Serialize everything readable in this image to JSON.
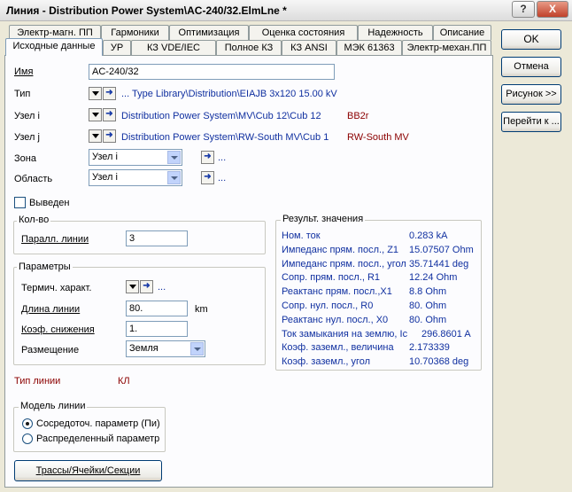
{
  "window": {
    "title": "Линия - Distribution Power System\\AC-240/32.ElmLne *",
    "help_label": "?",
    "close_label": "X"
  },
  "tabs_row1": [
    "Электр-магн. ПП",
    "Гармоники",
    "Оптимизация",
    "Оценка состояния",
    "Надежность",
    "Описание"
  ],
  "tabs_row2": [
    "Исходные данные",
    "УР",
    "КЗ VDE/IEC",
    "Полное КЗ",
    "КЗ ANSI",
    "МЭК 61363",
    "Электр-механ.ПП"
  ],
  "active_tab": "Исходные данные",
  "side_buttons": {
    "ok": "OK",
    "cancel": "Отмена",
    "figure": "Рисунок >>",
    "goto": "Перейти к ..."
  },
  "form": {
    "name_label": "Имя",
    "name_value": "AC-240/32",
    "type_label": "Тип",
    "type_value": "... Type Library\\Distribution\\EIAJB 3x120  15.00 kV",
    "node_i_label": "Узел i",
    "node_i_value": "Distribution Power System\\MV\\Cub 12\\Cub 12",
    "node_i_code": "BB2r",
    "node_j_label": "Узел j",
    "node_j_value": "Distribution Power System\\RW-South MV\\Cub 1",
    "node_j_code": "RW-South MV",
    "zone_label": "Зона",
    "zone_value": "Узел i",
    "area_label": "Область",
    "area_value": "Узел i",
    "ellipsis": "...",
    "out_of_service_label": "Выведен",
    "out_of_service_checked": false
  },
  "count_group": {
    "title": "Кол-во",
    "parallel_label": "Паралл. линии",
    "parallel_value": "3"
  },
  "params_group": {
    "title": "Параметры",
    "thermal_label": "Термич. характ.",
    "thermal_ellipsis": "...",
    "length_label": "Длина линии",
    "length_value": "80.",
    "length_unit": "km",
    "derating_label": "Коэф. снижения",
    "derating_value": "1.",
    "placement_label": "Размещение",
    "placement_value": "Земля"
  },
  "line_type": {
    "label": "Тип линии",
    "value": "КЛ"
  },
  "model_group": {
    "title": "Модель линии",
    "options": [
      "Сосредоточ. параметр (Пи)",
      "Распределенный параметр"
    ],
    "selected_index": 0
  },
  "routes_button": "Трассы/Ячейки/Секции",
  "results_group": {
    "title": "Результ. значения",
    "rows": [
      {
        "label": "Ном. ток",
        "value": "0.283 kA"
      },
      {
        "label": "Импеданс прям. посл., Z1",
        "value": "15.07507 Ohm"
      },
      {
        "label": "Импеданс прям. посл., угол",
        "value": "35.71441 deg"
      },
      {
        "label": "Сопр. прям. посл., R1",
        "value": "12.24 Ohm"
      },
      {
        "label": "Реактанс прям. посл.,X1",
        "value": "8.8 Ohm"
      },
      {
        "label": "Сопр. нул. посл., R0",
        "value": "80. Ohm"
      },
      {
        "label": "Реактанс нул. посл., X0",
        "value": "80. Ohm"
      },
      {
        "label": "Ток замыкания на землю, Ic",
        "value": "296.8601 A"
      },
      {
        "label": "Коэф. заземл., величина",
        "value": "2.173339"
      },
      {
        "label": "Коэф. заземл., угол",
        "value": "10.70368 deg"
      }
    ]
  }
}
